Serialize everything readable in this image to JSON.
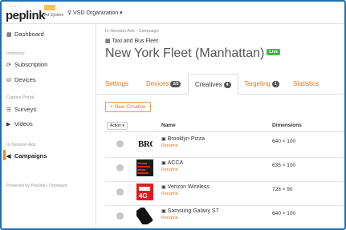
{
  "header": {
    "logo_text": "peplink",
    "logo_subtitle": "Ad System",
    "org_label": "VSD Organization ▾",
    "colors": {
      "accent": "#e2781e",
      "frame": "#1a6fb5"
    }
  },
  "sidebar": {
    "items": [
      {
        "label": "Dashboard",
        "icon": "dashboard-icon",
        "glyph": "▦"
      },
      {
        "section": "Inventory"
      },
      {
        "label": "Subscription",
        "icon": "subscription-icon",
        "glyph": "⟳"
      },
      {
        "label": "Devices",
        "icon": "devices-icon",
        "glyph": "⛁"
      },
      {
        "section": "Captive Portal"
      },
      {
        "label": "Surveys",
        "icon": "surveys-icon",
        "glyph": "☰"
      },
      {
        "label": "Videos",
        "icon": "videos-icon",
        "glyph": "▶"
      },
      {
        "section": "In-Session Ads"
      },
      {
        "label": "Campaigns",
        "icon": "campaigns-icon",
        "glyph": "◀",
        "active": true
      }
    ],
    "powered_by": "Powered by Peplink | Pepwave"
  },
  "main": {
    "breadcrumb": "In-Session Ads - Campaign",
    "subtitle": "Taxi and Bus Fleet",
    "title": "New York Fleet (Manhattan)",
    "status_badge": "Live",
    "tabs": [
      {
        "label": "Settings",
        "badge": ""
      },
      {
        "label": "Devices",
        "badge": "2/3"
      },
      {
        "label": "Creatives",
        "badge": "4",
        "active": true
      },
      {
        "label": "Targeting",
        "badge": "1"
      },
      {
        "label": "Statistics",
        "badge": ""
      }
    ],
    "new_button": "+ New Creative",
    "table": {
      "action_label": "Action ▾",
      "columns": [
        "Name",
        "Dimensions"
      ],
      "rows": [
        {
          "name": "Brooklyn Pizza",
          "action": "Rename",
          "dimensions": "640 × 100",
          "thumb_text": "BRO"
        },
        {
          "name": "ACCA",
          "action": "Rename",
          "dimensions": "635 × 100"
        },
        {
          "name": "Verizon Wireless",
          "action": "Rename",
          "dimensions": "728 × 90",
          "thumb_text": "4G"
        },
        {
          "name": "Samsung Galaxy S7",
          "action": "Rename",
          "dimensions": "640 × 100"
        }
      ]
    }
  }
}
